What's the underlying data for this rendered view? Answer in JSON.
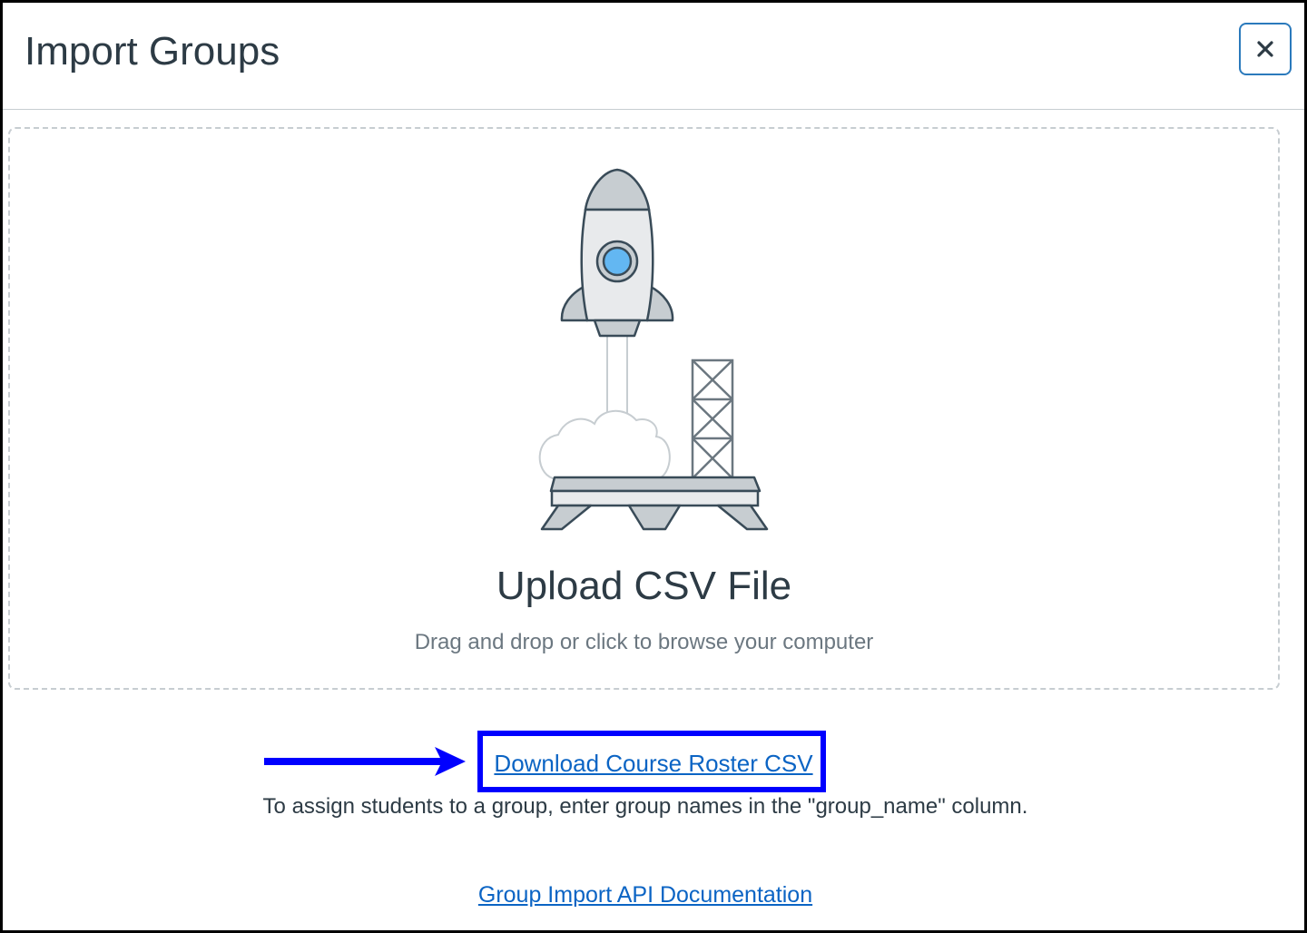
{
  "modal": {
    "title": "Import Groups",
    "close_icon": "close-icon"
  },
  "upload": {
    "illustration": "rocket-launch-illustration",
    "title": "Upload CSV File",
    "subtitle": "Drag and drop or click to browse your computer"
  },
  "links": {
    "roster_csv": "Download Course Roster CSV",
    "api_docs": "Group Import API Documentation"
  },
  "hint": "To assign students to a group, enter group names in the \"group_name\" column.",
  "annotation": {
    "arrow_icon": "arrow-right-icon",
    "highlight_color": "#0000ff"
  },
  "colors": {
    "text_primary": "#2d3b45",
    "text_secondary": "#6b7780",
    "link": "#0b64c4",
    "close_border": "#2b7abc"
  }
}
